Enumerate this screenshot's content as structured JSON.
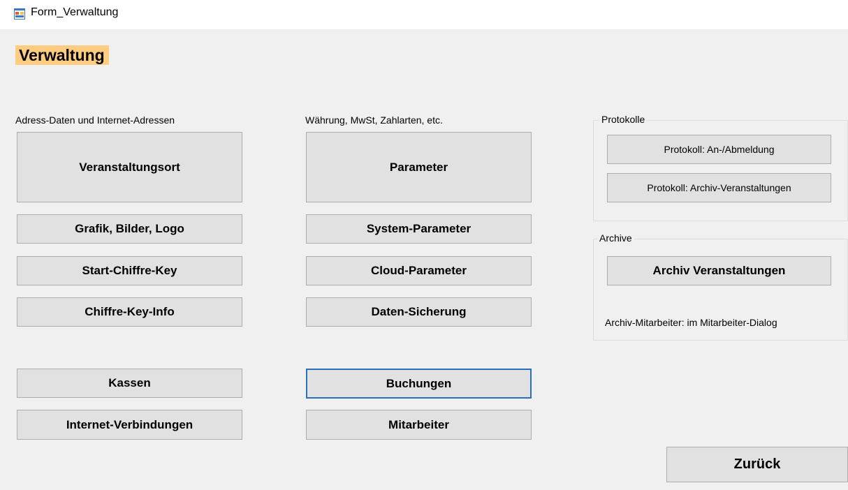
{
  "window": {
    "title": "Form_Verwaltung"
  },
  "header": {
    "title": "Verwaltung"
  },
  "columns": {
    "left": {
      "label": "Adress-Daten und Internet-Adressen",
      "buttons": [
        "Veranstaltungsort",
        "Grafik, Bilder, Logo",
        "Start-Chiffre-Key",
        "Chiffre-Key-Info",
        "Kassen",
        "Internet-Verbindungen"
      ]
    },
    "middle": {
      "label": "Währung, MwSt, Zahlarten,  etc.",
      "buttons": [
        "Parameter",
        "System-Parameter",
        "Cloud-Parameter",
        "Daten-Sicherung",
        "Buchungen",
        "Mitarbeiter"
      ]
    }
  },
  "protokolle": {
    "caption": "Protokolle",
    "buttons": [
      "Protokoll: An-/Abmeldung",
      "Protokoll: Archiv-Veranstaltungen"
    ]
  },
  "archive": {
    "caption": "Archive",
    "button": "Archiv Veranstaltungen",
    "note": "Archiv-Mitarbeiter:  im Mitarbeiter-Dialog"
  },
  "footer": {
    "back_label": "Zurück"
  },
  "colors": {
    "header_bg": "#ffcc80",
    "focus_border": "#2a6fb8",
    "button_bg": "#e1e1e1"
  }
}
